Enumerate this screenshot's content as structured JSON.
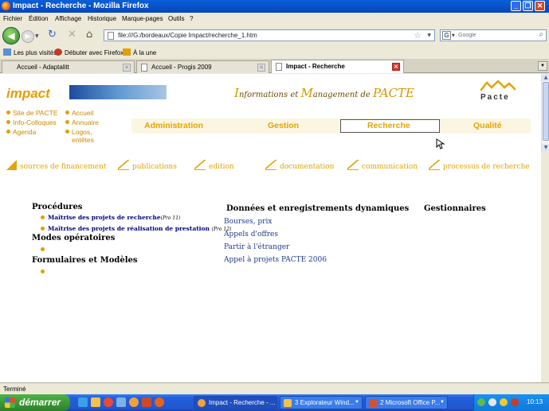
{
  "window": {
    "title": "Impact - Recherche - Mozilla Firefox"
  },
  "menu": [
    "Fichier",
    "Édition",
    "Affichage",
    "Historique",
    "Marque-pages",
    "Outils",
    "?"
  ],
  "nav": {
    "url": "file:///G:/bordeaux/Copie Impact/recherche_1.htm",
    "search_placeholder": "Google"
  },
  "bookmarks": [
    "Les plus visités",
    "Débuter avec Firefox",
    "À la une"
  ],
  "tabs": [
    {
      "label": "Accueil - Adaptalitt",
      "active": false
    },
    {
      "label": "Accueil - Progis 2009",
      "active": false
    },
    {
      "label": "Impact - Recherche",
      "active": true
    }
  ],
  "page": {
    "logo": "impact",
    "headline": {
      "i": "I",
      "nformations": "nformations et ",
      "m": "M",
      "anagement": "anagement de ",
      "pacte": "PACTE"
    },
    "pacte_logo": "Pacte",
    "left_links_col1": [
      "Site de PACTE",
      "Info-Colloques",
      "Agenda"
    ],
    "left_links_col2": [
      "Accueil",
      "Annuaire",
      "Logos,",
      "entêtes"
    ],
    "top_menu": [
      "Administration",
      "Gestion",
      "Recherche",
      "Qualité"
    ],
    "sub_nav": [
      "sources de financement",
      "publications",
      "edition",
      "documentation",
      "communication",
      "processus de recherche"
    ],
    "sections": {
      "procedures": "Procédures",
      "proc_items": [
        {
          "label": "Maîtrise des projets de recherche",
          "ref": "(Pro 11)"
        },
        {
          "label": "Maîtrise des projets de réalisation de prestation",
          "ref": "(Pro 12)"
        }
      ],
      "modes": "Modes opératoires",
      "formulaires": "Formulaires et Modèles",
      "donnees": "Données et enregistrements dynamiques",
      "donnees_items": [
        "Bourses, prix",
        "Appels d'offres",
        "Partir à l'étranger",
        "Appel à projets PACTE 2006"
      ],
      "gestionnaires": "Gestionnaires"
    }
  },
  "status": "Terminé",
  "taskbar": {
    "start": "démarrer",
    "tasks": [
      "Impact - Recherche - ...",
      "3 Explorateur Wind...",
      "2 Microsoft Office P..."
    ],
    "clock": "10:13"
  }
}
